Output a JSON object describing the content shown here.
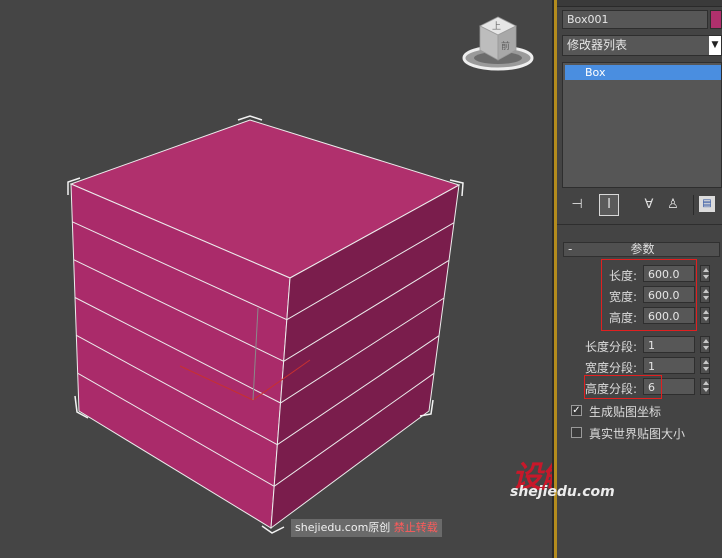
{
  "viewcube": {
    "face_top": "上",
    "face_front": "前"
  },
  "panel": {
    "object_name": "Box001",
    "object_color": "#b0306d",
    "modifier_list": "修改器列表",
    "stack_items": [
      "Box"
    ],
    "rollout_collapse": "-",
    "rollout_title": "参数",
    "params": [
      {
        "label": "长度:",
        "value": "600.0"
      },
      {
        "label": "宽度:",
        "value": "600.0"
      },
      {
        "label": "高度:",
        "value": "600.0"
      }
    ],
    "segments": [
      {
        "label": "长度分段:",
        "value": "1"
      },
      {
        "label": "宽度分段:",
        "value": "1"
      },
      {
        "label": "高度分段:",
        "value": "6"
      }
    ],
    "checkboxes": [
      {
        "label": "生成贴图坐标",
        "checked": true,
        "mark": "✓"
      },
      {
        "label": "真实世界贴图大小",
        "checked": false,
        "mark": ""
      }
    ]
  },
  "watermark": {
    "logo": "设解读",
    "domain": "shejiedu.com",
    "caption_site": "shejiedu.com原创",
    "caption_warning": "禁止转载"
  },
  "colors": {
    "box_top": "#b0306d",
    "box_front": "#aa2b6a",
    "box_side": "#7a1d4c",
    "accent_select": "#4a8ee0",
    "highlight_red": "#e02020",
    "panel_gold": "#b48c1e"
  },
  "geometry": {
    "height_segments": 6
  }
}
